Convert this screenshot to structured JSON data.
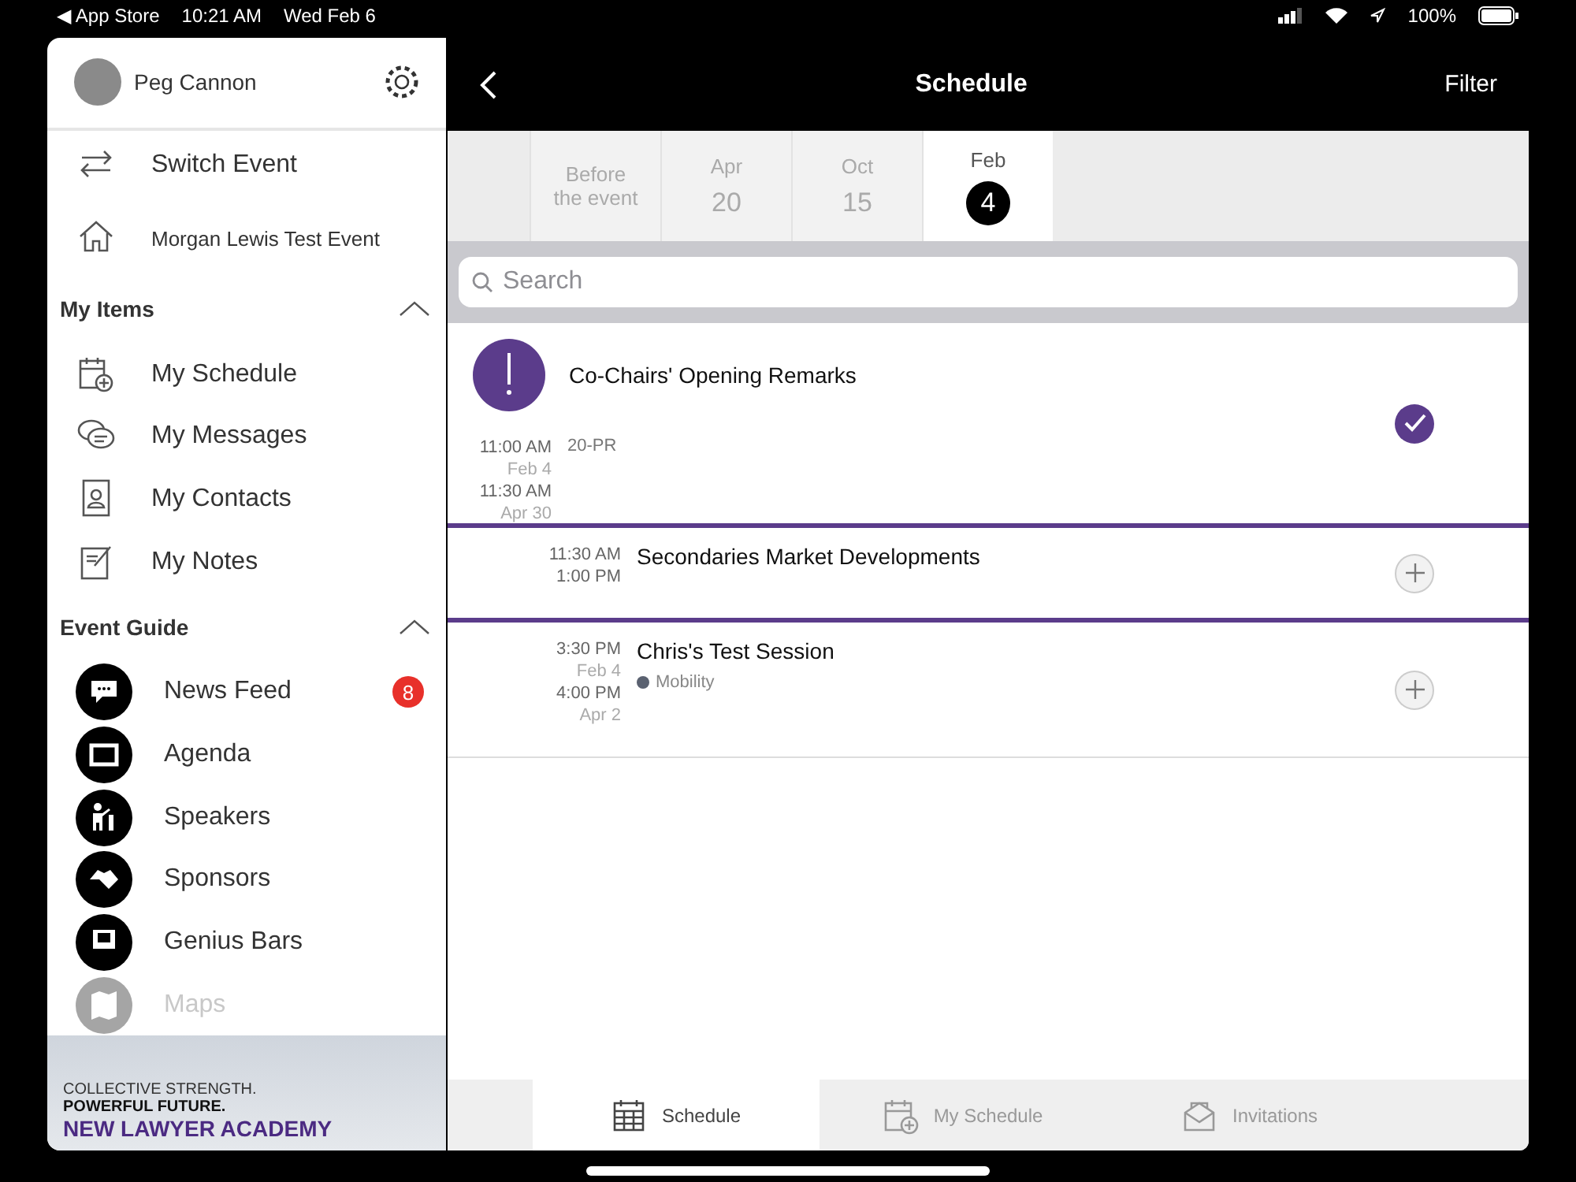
{
  "status_bar": {
    "back_app": "◀ App Store",
    "time": "10:21 AM",
    "date": "Wed Feb 6",
    "battery": "100%"
  },
  "sidebar": {
    "user": {
      "name": "Peg Cannon"
    },
    "top_items": [
      {
        "label": "Switch Event",
        "kind": "switch"
      },
      {
        "label": "Morgan Lewis Test Event",
        "kind": "home"
      }
    ],
    "sections": [
      {
        "title": "My Items",
        "expanded": true,
        "items": [
          {
            "label": "My Schedule",
            "kind": "schedule-add"
          },
          {
            "label": "My Messages",
            "kind": "messages"
          },
          {
            "label": "My Contacts",
            "kind": "contacts"
          },
          {
            "label": "My Notes",
            "kind": "notes"
          }
        ]
      },
      {
        "title": "Event Guide",
        "expanded": true,
        "items": [
          {
            "label": "News Feed",
            "kind": "news",
            "badge": "8"
          },
          {
            "label": "Agenda",
            "kind": "agenda"
          },
          {
            "label": "Speakers",
            "kind": "speakers"
          },
          {
            "label": "Sponsors",
            "kind": "sponsors"
          },
          {
            "label": "Genius Bars",
            "kind": "genius"
          },
          {
            "label": "Maps",
            "kind": "maps",
            "faded": true
          }
        ]
      }
    ],
    "banner": {
      "line_1": "COLLECTIVE STRENGTH.",
      "line_2": "POWERFUL FUTURE.",
      "line_3": "NEW LAWYER ACADEMY"
    }
  },
  "header": {
    "title": "Schedule",
    "action": "Filter"
  },
  "date_tabs": [
    {
      "month": "Before",
      "day": "the event",
      "selected": false,
      "kind": "text"
    },
    {
      "month": "Apr",
      "day": "20",
      "selected": false,
      "kind": "date"
    },
    {
      "month": "Oct",
      "day": "15",
      "selected": false,
      "kind": "date"
    },
    {
      "month": "Feb",
      "day": "4",
      "selected": true,
      "kind": "date"
    }
  ],
  "search": {
    "placeholder": "Search"
  },
  "sessions": [
    {
      "title": "Co-Chairs' Opening Remarks",
      "alert": true,
      "start": "11:00 AM",
      "start_date": "Feb 4",
      "end": "11:30 AM",
      "end_date": "Apr 30",
      "location": "20-PR",
      "added": true
    },
    {
      "title": "Secondaries Market Developments",
      "alert": false,
      "start": "11:30 AM",
      "end": "1:00 PM",
      "added": false
    },
    {
      "title": "Chris's Test Session",
      "alert": false,
      "start": "3:30 PM",
      "start_date": "Feb 4",
      "end": "4:00 PM",
      "end_date": "Apr 2",
      "track": {
        "label": "Mobility",
        "color": "#5a6170"
      },
      "added": false
    }
  ],
  "bottom_tabs": [
    {
      "label": "Schedule",
      "kind": "calendar",
      "selected": true
    },
    {
      "label": "My Schedule",
      "kind": "calendar-add",
      "selected": false
    },
    {
      "label": "Invitations",
      "kind": "envelope",
      "selected": false
    }
  ]
}
